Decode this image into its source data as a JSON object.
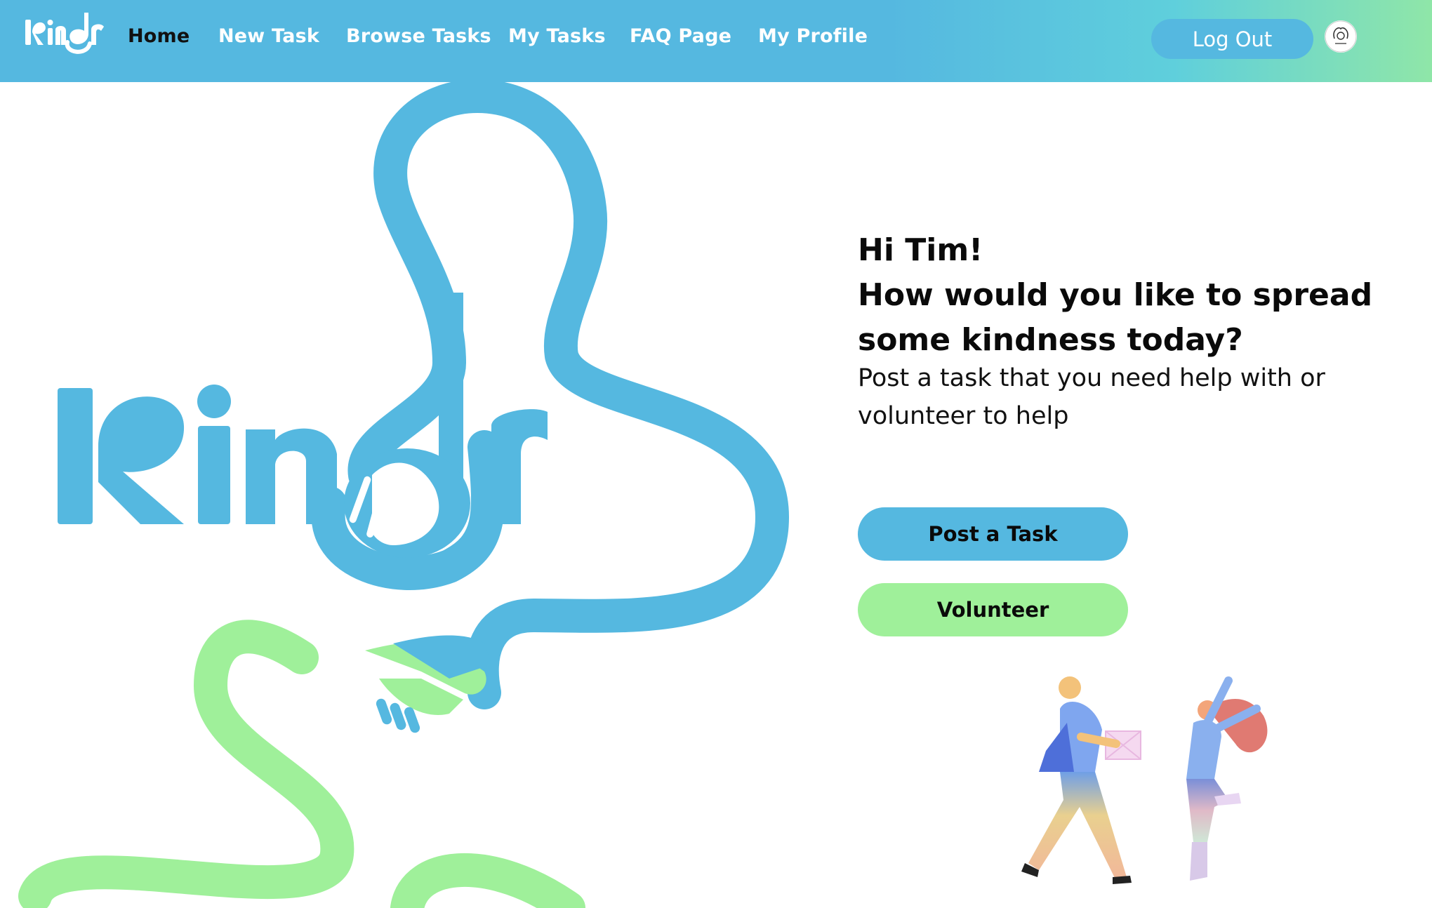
{
  "header": {
    "brand_name": "Kindr",
    "nav_items": [
      {
        "label": "Home",
        "active": true
      },
      {
        "label": "New Task",
        "active": false
      },
      {
        "label": "Browse Tasks",
        "active": false
      },
      {
        "label": "My Tasks",
        "active": false
      },
      {
        "label": "FAQ Page",
        "active": false
      },
      {
        "label": "My Profile",
        "active": false
      }
    ],
    "logout_label": "Log Out",
    "avatar_icon": "user-avatar-icon"
  },
  "hero": {
    "logo_text": "Kindr",
    "greeting_line1": "Hi Tim!",
    "greeting_line2": "How would you like to spread some kindness today?",
    "subtext": "Post a task that you need help with or volunteer to help",
    "post_task_label": "Post a Task",
    "volunteer_label": "Volunteer"
  },
  "colors": {
    "brand_blue": "#55b8e0",
    "brand_green": "#9ff09a",
    "text_dark": "#0a0a0a"
  }
}
